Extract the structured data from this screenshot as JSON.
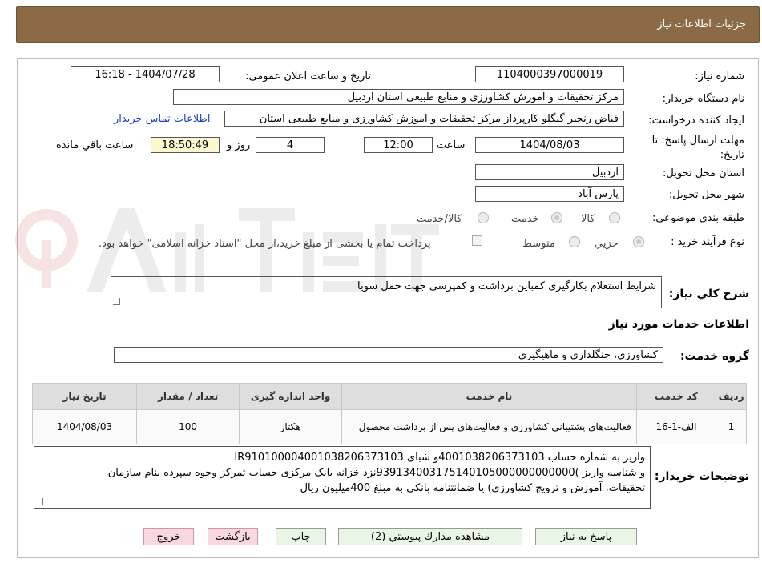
{
  "header": {
    "title": "جزئیات اطلاعات نیاز"
  },
  "need_number": {
    "label": "شماره نیاز:",
    "value": "1104000397000019"
  },
  "announce": {
    "label": "تاریخ و ساعت اعلان عمومی:",
    "value": "1404/07/28 - 16:18"
  },
  "buyer_org": {
    "label": "نام دستگاه خریدار:",
    "value": "مرکز تحقیقات و اموزش کشاورزی و منابع طبیعی استان اردبیل"
  },
  "requester": {
    "label": "ایجاد کننده درخواست:",
    "value": "فیاض رنجبر گیگلو کارپرداز مرکز تحقیقات و اموزش کشاورزی و منابع طبیعی استان",
    "contact_link": "اطلاعات تماس خریدار"
  },
  "deadline": {
    "label": "مهلت ارسال پاسخ: تا تاریخ:",
    "date": "1404/08/03",
    "time_label": "ساعت",
    "time": "12:00",
    "days": "4",
    "days_label": "روز و",
    "remaining": "18:50:49",
    "remaining_label": "ساعت باقي مانده"
  },
  "province": {
    "label": "استان محل تحویل:",
    "value": "اردبیل"
  },
  "city": {
    "label": "شهر محل تحویل:",
    "value": "پارس آباد"
  },
  "category": {
    "label": "طبقه بندی موضوعی:",
    "options": [
      "کالا",
      "خدمت",
      "کالا/خدمت"
    ],
    "selected": "خدمت"
  },
  "process": {
    "label": "نوع فرآیند خرید :",
    "options": [
      "جزیي",
      "متوسط"
    ],
    "selected": "جزیي",
    "payment_note": "پرداخت تمام یا بخشی از مبلغ خرید،از محل \"اسناد خزانه اسلامی\" خواهد بود."
  },
  "description": {
    "label": "شرح کلي نیاز:",
    "value": "شرایط استعلام بکارگیری کمباین برداشت و کمپرسی جهت حمل سویا"
  },
  "services_title": "اطلاعات خدمات مورد نیاز",
  "service_group": {
    "label": "گروه خدمت:",
    "value": "کشاورزی، جنگلداری و ماهیگیری"
  },
  "table": {
    "headers": [
      "ردیف",
      "کد خدمت",
      "نام خدمت",
      "واحد اندازه گیری",
      "تعداد / مقدار",
      "تاریخ نیاز"
    ],
    "rows": [
      [
        "1",
        "الف-1-16",
        "فعالیت‌های پشتیبانی کشاورزی و فعالیت‌های پس از برداشت محصول",
        "هکتار",
        "100",
        "1404/08/03"
      ]
    ]
  },
  "buyer_notes": {
    "label": "توضیحات خریدار:",
    "lines": [
      "واریز به شماره حساب  4001038206373103و شبای IR910100004001038206373103",
      "و شناسه واریز  )939134003175140105000000000000نزد خزانه بانک مرکزی حساب تمرکز وجوه سپرده بنام سازمان",
      "تحقیقات، آموزش و ترویج کشاورزی) یا ضمانتنامه بانکی به مبلغ  400میلیون ریال"
    ]
  },
  "buttons": {
    "reply": "پاسخ به نیاز",
    "attachments": "مشاهده مدارك پيوستي (2)",
    "print": "چاپ",
    "back": "بازگشت",
    "exit": "خروج"
  }
}
